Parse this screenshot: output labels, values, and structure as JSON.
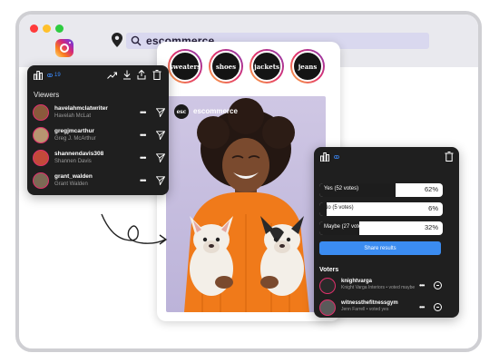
{
  "browser": {
    "dots": [
      "#ff3b3b",
      "#ffc02b",
      "#2ecc40"
    ],
    "search_text": "escommerce"
  },
  "stories": [
    {
      "label": "sweaters"
    },
    {
      "label": "shoes"
    },
    {
      "label": "jackets"
    },
    {
      "label": "jeans"
    }
  ],
  "post": {
    "avatar_text": "esc",
    "username": "escommerce"
  },
  "viewers_panel": {
    "count": "19",
    "title": "Viewers",
    "viewers": [
      {
        "username": "havelahmclatwriter",
        "name": "Havelah McLat",
        "avatar_color": "#8a5a3c"
      },
      {
        "username": "gregjmcarthur",
        "name": "Greg J. McArthur",
        "avatar_color": "#b89570"
      },
      {
        "username": "shannendavis308",
        "name": "Shannen Davis",
        "avatar_color": "#c24a3a"
      },
      {
        "username": "grant_walden",
        "name": "Grant Walden",
        "avatar_color": "#7c6a55"
      }
    ]
  },
  "poll_panel": {
    "options": [
      {
        "label": "Yes (52 votes)",
        "pct": "62%",
        "fill": 0.62
      },
      {
        "label": "No (5 votes)",
        "pct": "6%",
        "fill": 0.06
      },
      {
        "label": "Maybe (27 votes)",
        "pct": "32%",
        "fill": 0.32
      }
    ],
    "share_label": "Share results",
    "voters_title": "Voters",
    "voters": [
      {
        "username": "knightvarga",
        "sub": "Knight Varga Interiors • voted maybe"
      },
      {
        "username": "witnessthefitnessgym",
        "sub": "Jenn Farrell • voted yes"
      }
    ]
  },
  "colors": {
    "accent_blue": "#3b8cf1",
    "panel_dark": "#1f1f1f",
    "instagram_pink": "#e1306c"
  }
}
